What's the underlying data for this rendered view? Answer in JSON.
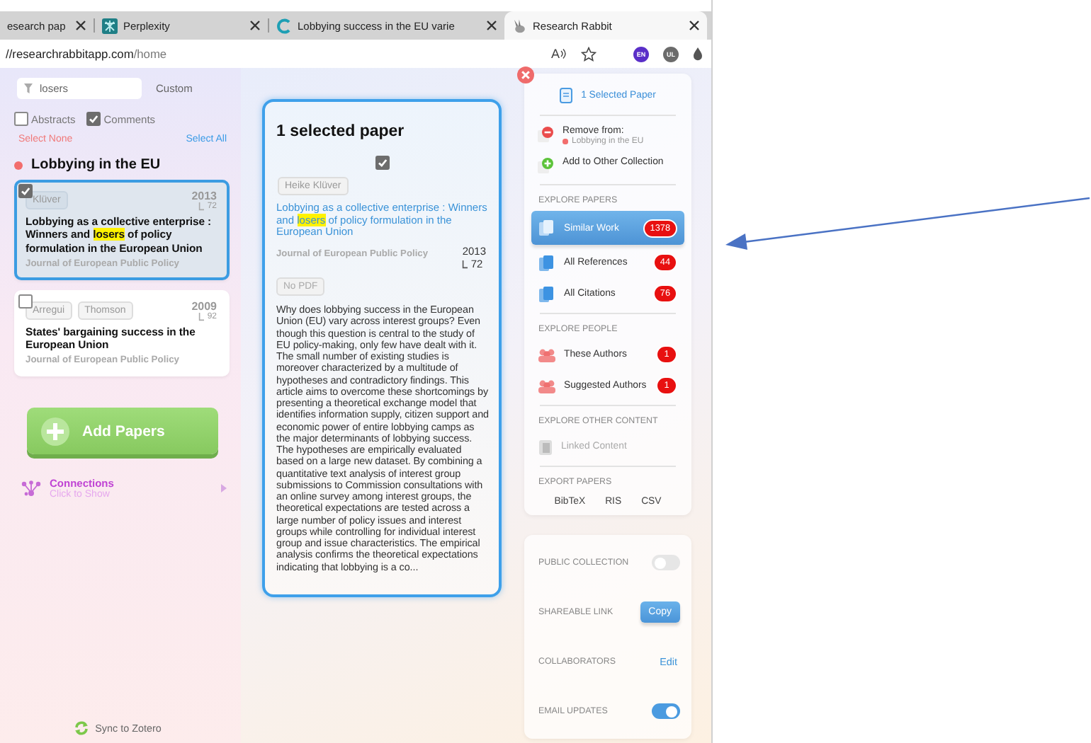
{
  "browser_tabs": [
    {
      "label": "esearch pap",
      "kind": "plain",
      "selected": false
    },
    {
      "label": "Perplexity",
      "kind": "grid",
      "selected": false
    },
    {
      "label": "Lobbying success in the EU varie",
      "kind": "c-logo",
      "selected": false
    },
    {
      "label": "Research Rabbit",
      "kind": "rabbit",
      "selected": true
    }
  ],
  "address_bar": {
    "host": "//researchrabbitapp.com",
    "path": "/home",
    "read_aloud": "A"
  },
  "profiles": [
    {
      "label": "EN",
      "color": "#5a2fc8"
    },
    {
      "label": "UL",
      "color": "#6b6b6b"
    }
  ],
  "sidebar": {
    "filter": {
      "value": "losers"
    },
    "custom": "Custom",
    "options": [
      {
        "label": "Abstracts",
        "checked": false
      },
      {
        "label": "Comments",
        "checked": true
      }
    ],
    "select_none": "Select None",
    "select_all": "Select All",
    "collection": {
      "title": "Lobbying in the EU",
      "color": "#f26d6d"
    },
    "papers": [
      {
        "authors": [
          "Klüver"
        ],
        "year": "2013",
        "citations": "72",
        "title": [
          {
            "text": "Lobbying as a collective enterprise : Winners and ",
            "highlight": false
          },
          {
            "text": "losers",
            "highlight": true
          },
          {
            "text": " of policy formulation in the European Union",
            "highlight": false
          }
        ],
        "journal": "Journal of European Public Policy",
        "checked": true,
        "selected": true
      },
      {
        "authors": [
          "Arregui",
          "Thomson"
        ],
        "year": "2009",
        "citations": "92",
        "title": [
          {
            "text": "States' bargaining success in the European Union",
            "highlight": false
          }
        ],
        "journal": "Journal of European Public Policy",
        "checked": false,
        "selected": false
      }
    ],
    "add_button": "Add Papers",
    "connections": {
      "title": "Connections",
      "subtitle": "Click to Show"
    },
    "sync": "Sync to Zotero"
  },
  "detail": {
    "heading": "1 selected paper",
    "checked": true,
    "author": "Heike Klüver",
    "title": [
      {
        "text": "Lobbying as a collective enterprise : Winners and ",
        "highlight": false
      },
      {
        "text": "losers",
        "highlight": true
      },
      {
        "text": " of policy formulation in the European Union",
        "highlight": false
      }
    ],
    "journal": "Journal of European Public Policy",
    "year": "2013",
    "citations": "72",
    "pdf": "No PDF",
    "abstract": "Why does lobbying success in the European Union (EU) vary across interest groups? Even though this question is central to the study of EU policy-making, only few have dealt with it. The small number of existing studies is moreover characterized by a multitude of hypotheses and contradictory findings. This article aims to overcome these shortcomings by presenting a theoretical exchange model that identifies information supply, citizen support and economic power of entire lobbying camps as the major determinants of lobbying success. The hypotheses are empirically evaluated based on a large new dataset. By combining a quantitative text analysis of interest group submissions to Commission consultations with an online survey among interest groups, the theoretical expectations are tested across a large number of policy issues and interest groups while controlling for individual interest group and issue characteristics. The empirical analysis confirms the theoretical expectations indicating that lobbying is a co..."
  },
  "actions": {
    "selected": "1 Selected Paper",
    "remove": {
      "label": "Remove from:",
      "collection": "Lobbying in the EU",
      "color": "#f26d6d"
    },
    "add_other": "Add to Other Collection",
    "sections": [
      {
        "heading": "EXPLORE PAPERS",
        "items": [
          {
            "label": "Similar Work",
            "count": "1378",
            "kind": "paper",
            "selected": true,
            "disabled": false
          },
          {
            "label": "All References",
            "count": "44",
            "kind": "paper",
            "selected": false,
            "disabled": false
          },
          {
            "label": "All Citations",
            "count": "76",
            "kind": "paper",
            "selected": false,
            "disabled": false
          }
        ]
      },
      {
        "heading": "EXPLORE PEOPLE",
        "items": [
          {
            "label": "These Authors",
            "count": "1",
            "kind": "people",
            "selected": false,
            "disabled": false
          },
          {
            "label": "Suggested Authors",
            "count": "1",
            "kind": "people",
            "selected": false,
            "disabled": false
          }
        ]
      },
      {
        "heading": "EXPLORE OTHER CONTENT",
        "items": [
          {
            "label": "Linked Content",
            "kind": "linked",
            "selected": false,
            "disabled": true
          }
        ]
      }
    ],
    "export": {
      "heading": "EXPORT PAPERS",
      "formats": [
        "BibTeX",
        "RIS",
        "CSV"
      ]
    }
  },
  "settings": [
    {
      "label": "PUBLIC COLLECTION",
      "kind": "toggle",
      "on": false
    },
    {
      "label": "SHAREABLE LINK",
      "kind": "button",
      "action": "Copy"
    },
    {
      "label": "COLLABORATORS",
      "kind": "link",
      "action": "Edit"
    },
    {
      "label": "EMAIL UPDATES",
      "kind": "toggle",
      "on": true
    }
  ]
}
